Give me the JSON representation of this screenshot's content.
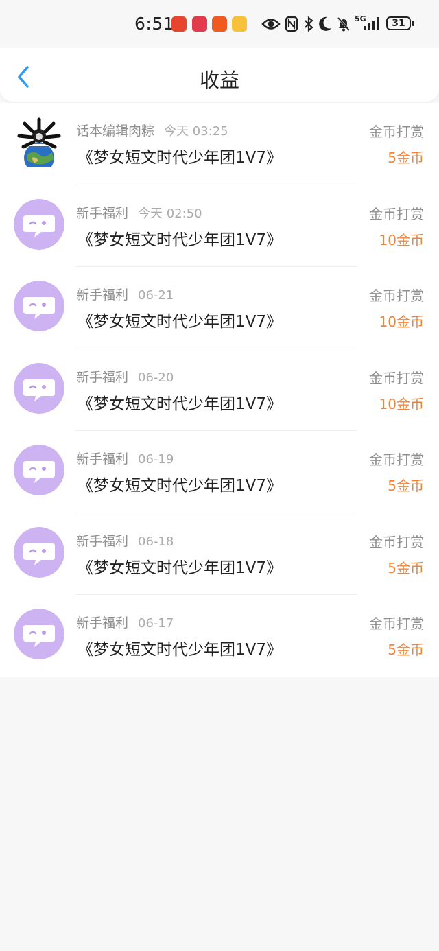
{
  "status_bar": {
    "time": "6:51",
    "network": "5G",
    "battery": "31",
    "icons": [
      "eye-icon",
      "nfc-icon",
      "bluetooth-icon",
      "moon-icon",
      "bell-off-icon",
      "signal-icon"
    ]
  },
  "header": {
    "title": "收益"
  },
  "rows": [
    {
      "name": "话本编辑肉粽",
      "date": "今天 03:25",
      "book": "《梦女短文时代少年团1V7》",
      "type": "金币打赏",
      "amount": "5金币",
      "avatar": "editor-avatar"
    },
    {
      "name": "新手福利",
      "date": "今天 02:50",
      "book": "《梦女短文时代少年团1V7》",
      "type": "金币打赏",
      "amount": "10金币",
      "avatar": "bot-avatar"
    },
    {
      "name": "新手福利",
      "date": "06-21",
      "book": "《梦女短文时代少年团1V7》",
      "type": "金币打赏",
      "amount": "10金币",
      "avatar": "bot-avatar"
    },
    {
      "name": "新手福利",
      "date": "06-20",
      "book": "《梦女短文时代少年团1V7》",
      "type": "金币打赏",
      "amount": "10金币",
      "avatar": "bot-avatar"
    },
    {
      "name": "新手福利",
      "date": "06-19",
      "book": "《梦女短文时代少年团1V7》",
      "type": "金币打赏",
      "amount": "5金币",
      "avatar": "bot-avatar"
    },
    {
      "name": "新手福利",
      "date": "06-18",
      "book": "《梦女短文时代少年团1V7》",
      "type": "金币打赏",
      "amount": "5金币",
      "avatar": "bot-avatar"
    },
    {
      "name": "新手福利",
      "date": "06-17",
      "book": "《梦女短文时代少年团1V7》",
      "type": "金币打赏",
      "amount": "5金币",
      "avatar": "bot-avatar"
    }
  ],
  "colors": {
    "accent_blue": "#2f9bf0",
    "amount_orange": "#f0843a",
    "avatar_purple": "#cdb3f2"
  }
}
